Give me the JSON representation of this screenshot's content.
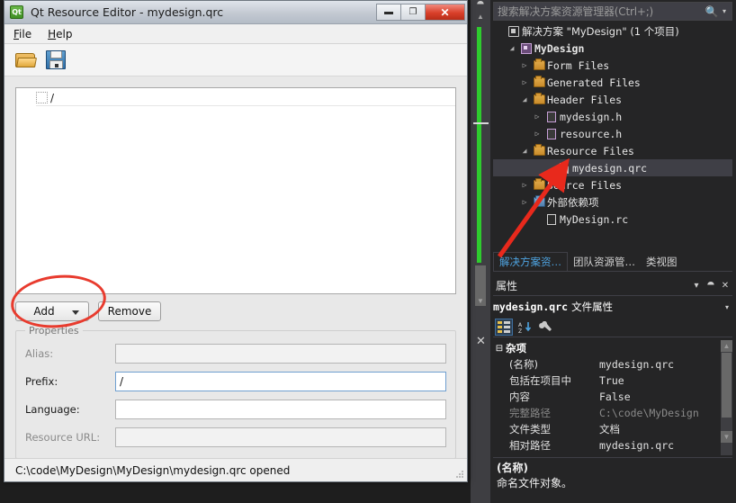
{
  "vs": {
    "search": {
      "placeholder": "搜索解决方案资源管理器(Ctrl+;)",
      "icon": "search-icon",
      "caret": "▾"
    },
    "tree": [
      {
        "label": "解决方案 \"MyDesign\" (1 个项目)",
        "icon": "solution-icon",
        "indent": 0,
        "twisty": "none",
        "cjk": true,
        "bold": false,
        "selected": false
      },
      {
        "label": "MyDesign",
        "icon": "project-icon",
        "indent": 1,
        "twisty": "open",
        "cjk": false,
        "bold": true,
        "selected": false
      },
      {
        "label": "Form Files",
        "icon": "folder-icon",
        "indent": 2,
        "twisty": "closed",
        "cjk": false,
        "bold": false,
        "selected": false
      },
      {
        "label": "Generated Files",
        "icon": "folder-icon",
        "indent": 2,
        "twisty": "closed",
        "cjk": false,
        "bold": false,
        "selected": false
      },
      {
        "label": "Header Files",
        "icon": "folder-open-icon",
        "indent": 2,
        "twisty": "open",
        "cjk": false,
        "bold": false,
        "selected": false
      },
      {
        "label": "mydesign.h",
        "icon": "header-file-icon",
        "indent": 3,
        "twisty": "closed",
        "cjk": false,
        "bold": false,
        "selected": false
      },
      {
        "label": "resource.h",
        "icon": "header-file-icon",
        "indent": 3,
        "twisty": "closed",
        "cjk": false,
        "bold": false,
        "selected": false
      },
      {
        "label": "Resource Files",
        "icon": "folder-open-icon",
        "indent": 2,
        "twisty": "open",
        "cjk": false,
        "bold": false,
        "selected": false
      },
      {
        "label": "mydesign.qrc",
        "icon": "file-icon",
        "indent": 4,
        "twisty": "none",
        "cjk": false,
        "bold": false,
        "selected": true
      },
      {
        "label": "Source Files",
        "icon": "folder-icon",
        "indent": 2,
        "twisty": "closed",
        "cjk": false,
        "bold": false,
        "selected": false
      },
      {
        "label": "外部依赖项",
        "icon": "folder-blue-icon",
        "indent": 2,
        "twisty": "closed",
        "cjk": true,
        "bold": false,
        "selected": false
      },
      {
        "label": "MyDesign.rc",
        "icon": "rc-file-icon",
        "indent": 3,
        "twisty": "none",
        "cjk": false,
        "bold": false,
        "selected": false
      }
    ],
    "tool_tabs": [
      {
        "label": "解决方案资…",
        "active": true
      },
      {
        "label": "团队资源管…",
        "active": false
      },
      {
        "label": "类视图",
        "active": false
      }
    ],
    "properties": {
      "title": "属性",
      "buttons": {
        "dropdown": "▾",
        "pin": "⯊",
        "close": "✕"
      },
      "subject_name": "mydesign.qrc",
      "subject_suffix": "文件属性",
      "subject_caret": "▾",
      "toolbar": [
        {
          "name": "categorized-view-icon",
          "active": true
        },
        {
          "name": "alphabetical-sort-icon",
          "active": false
        },
        {
          "name": "property-pages-wrench-icon",
          "active": false
        }
      ],
      "category": "杂项",
      "category_expander": "⊟",
      "rows": [
        {
          "key": "(名称)",
          "value": "mydesign.qrc",
          "dim": false,
          "cjk_value": false
        },
        {
          "key": "包括在项目中",
          "value": "True",
          "dim": false,
          "cjk_value": false
        },
        {
          "key": "内容",
          "value": "False",
          "dim": false,
          "cjk_value": false
        },
        {
          "key": "完整路径",
          "value": "C:\\code\\MyDesign",
          "dim": true,
          "cjk_value": false
        },
        {
          "key": "文件类型",
          "value": "文档",
          "dim": false,
          "cjk_value": true
        },
        {
          "key": "相对路径",
          "value": "mydesign.qrc",
          "dim": false,
          "cjk_value": false
        }
      ],
      "scroll": {
        "up": "▲",
        "down": "▼"
      },
      "description_title": "(名称)",
      "description_text": "命名文件对象。"
    },
    "editor_strip": {
      "pin": "⯊",
      "up": "▲",
      "down": "▼",
      "close": "✕",
      "change_bar_color": "#2ecc2e"
    }
  },
  "qt": {
    "window_title": "Qt Resource Editor - mydesign.qrc",
    "logo_text": "Qt",
    "window_buttons": {
      "minimize": "▬",
      "maximize": "❐",
      "close": "✕"
    },
    "menu": [
      {
        "label": "File",
        "mnemonic": "F"
      },
      {
        "label": "Help",
        "mnemonic": "H"
      }
    ],
    "toolbar": [
      {
        "name": "open-file-icon"
      },
      {
        "name": "save-file-icon"
      }
    ],
    "resource_tree": [
      {
        "label": "/",
        "selected": true
      }
    ],
    "buttons": {
      "add": "Add",
      "add_caret": "▾",
      "remove": "Remove"
    },
    "properties_group": {
      "legend": "Properties",
      "fields": [
        {
          "label": "Alias:",
          "value": "",
          "enabled": false,
          "focused": false
        },
        {
          "label": "Prefix:",
          "value": "/",
          "enabled": true,
          "focused": true
        },
        {
          "label": "Language:",
          "value": "",
          "enabled": true,
          "focused": false
        },
        {
          "label": "Resource URL:",
          "value": "",
          "enabled": false,
          "focused": false
        }
      ]
    },
    "status_bar": "C:\\code\\MyDesign\\MyDesign\\mydesign.qrc opened"
  },
  "annotations": {
    "circle_color": "#e83b2e",
    "arrow_color": "#e8291c",
    "circle_target": "add-button",
    "arrow_target": "mydesign-qrc-tree-node"
  }
}
